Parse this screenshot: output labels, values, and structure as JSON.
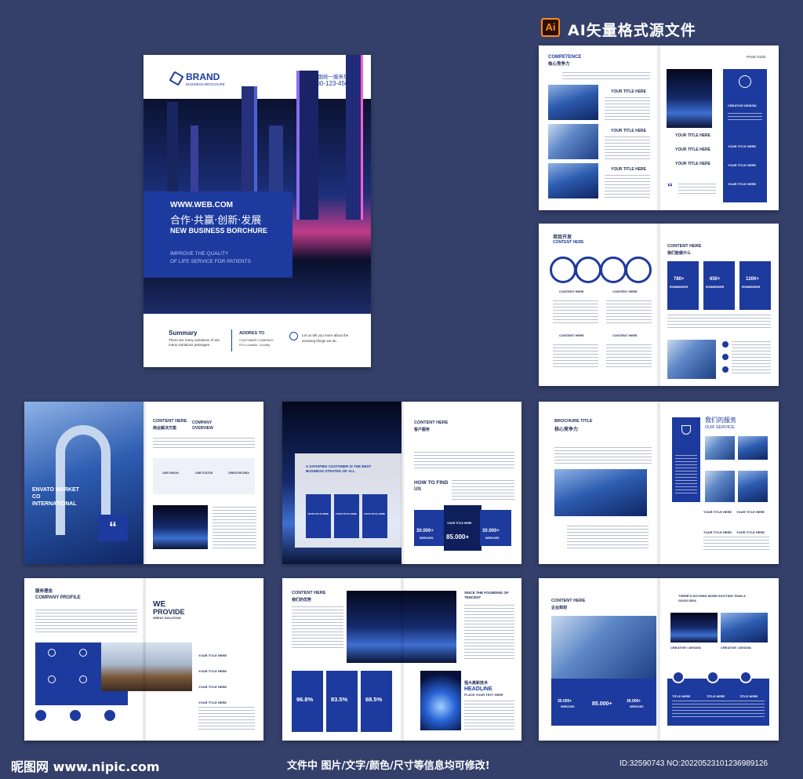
{
  "header": {
    "ai_badge": "Ai",
    "title": "AI矢量格式源文件"
  },
  "cover": {
    "brand": "BRAND",
    "brand_sub": "BUSINESS BROCHURE",
    "hotline_label": "全国统一服务热线",
    "hotline_number": "400-123-4567",
    "web": "WWW.WEB.COM",
    "slogan_cn": "合作·共赢·创新·发展",
    "slogan_en": "NEW BUSINESS BORCHURE",
    "tagline_1": "IMPROVE THE QUALITY",
    "tagline_2": "OF LIFE SERVICE FOR PATIENTS",
    "summary_title": "Summary",
    "summary_text_1": "There are many variations of  are",
    "summary_text_2": "many variations passages.",
    "address_title": "ADDRES TO",
    "address_1": "CUSTOMER COMPANY",
    "address_2": "5Th Location, Country",
    "contact_1": "Let us tell you more about the",
    "contact_2": "amazing things we do."
  },
  "spread_competence": {
    "title_en": "COMPETENCE",
    "title_cn": "核心竞争力",
    "page_num": "PAGE 01/02",
    "item_title": "YOUR TITLE HERE",
    "badge": "CREATIVE DESIGN",
    "quote": "“"
  },
  "spread_project": {
    "title_cn": "项目开发",
    "title_en": "CONTENT HERE",
    "content_title": "CONTENT HERE",
    "content_cn": "我们能做什么",
    "stats": [
      "780+",
      "650+",
      "1200+"
    ],
    "stat_label": "ROMMENDER",
    "item_label": "CONTENT HERE",
    "item_cn": "行业简述"
  },
  "spread_envato": {
    "heading": "ENVATO MARKET CO INTERNATIONAL",
    "content_title": "CONTENT HERE",
    "content_cn": "商业解决方案",
    "overview": "COMPANY OVERVIEW",
    "labels": [
      "OUR VISION",
      "OUR STATUS",
      "CREATIVE IDEA"
    ]
  },
  "spread_customer": {
    "quote_line": "A SATISFIED CUSTOMER IS THE BEST BUSINESS STRATEG OF ALL",
    "title_en": "CONTENT HERE",
    "title_cn": "客户服务",
    "how_to": "HOW TO FIND US",
    "box_label": "YOUR TITLE HERE",
    "stat_left": "30.000+",
    "stat_mid": "85.000+",
    "stat_right": "30.000+",
    "services": "SERVICES"
  },
  "spread_brochure": {
    "title_en": "BROCHURE TITLE",
    "title_cn": "核心竞争力",
    "service_cn": "我们的服务",
    "service_en": "OUR SERVICE",
    "item_title": "YOUR TITLE HERE"
  },
  "spread_profile": {
    "title_cn": "服务理念",
    "title_en": "COMPANY PROFILE",
    "we": "WE",
    "provide": "PROVIDE",
    "great": "GREAT SOLUTION",
    "item_title": "YOUR TITLE HERE"
  },
  "spread_tencent": {
    "title_en": "CONTENT HERE",
    "title_cn": "我们的优势",
    "since": "SINCE THE FOUNDING OF TENCENT",
    "percent": [
      "96.8%",
      "83.5%",
      "68.5%"
    ],
    "headline_cn": "强大高新技术",
    "headline": "HEADLINE",
    "place": "PLACE YOUR TEXT HERE"
  },
  "spread_plan": {
    "title_en": "CONTENT HERE",
    "title_cn": "企业规划",
    "exciting": "THERE'S NOTHING MORE EXCITING THAN A GOOD IDEA",
    "creative": "CREATIVE / DESIGN",
    "title_here": "TITLE HERE",
    "stat_left": "30.000+",
    "stat_mid": "85.000+",
    "stat_right": "30.000+",
    "services": "SERVICES"
  },
  "footer": {
    "watermark": "昵图网 www.nipic.com",
    "notice": "文件中 图片/文字/颜色/尺寸等信息均可修改!",
    "id_text": "ID:32590743 NO:20220523101236989126"
  }
}
